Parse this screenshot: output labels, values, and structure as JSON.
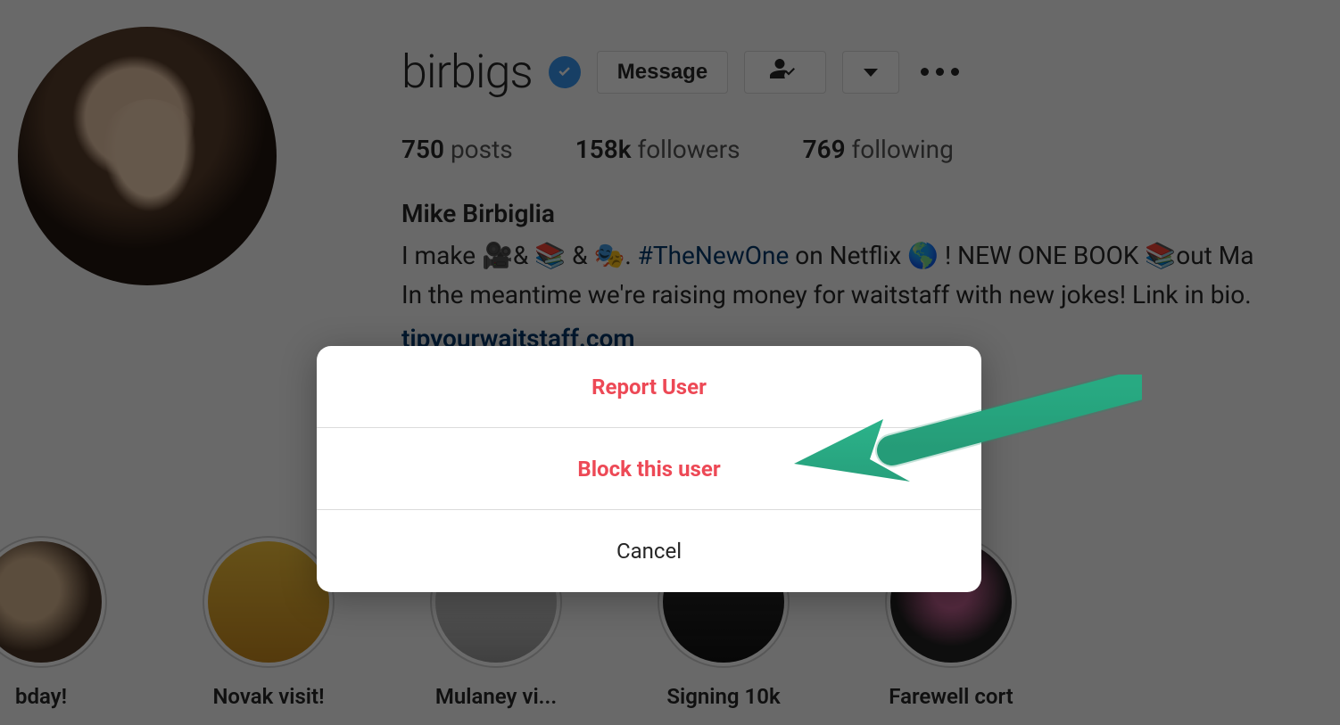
{
  "profile": {
    "username": "birbigs",
    "verified": true,
    "message_button_label": "Message",
    "stats": {
      "posts_count": "750",
      "posts_label": "posts",
      "followers_count": "158k",
      "followers_label": "followers",
      "following_count": "769",
      "following_label": "following"
    },
    "display_name": "Mike Birbiglia",
    "bio_line1_prefix": "I make 🎥& 📚 & 🎭. ",
    "bio_hashtag": "#TheNewOne",
    "bio_line1_suffix": " on Netflix 🌎 ! NEW ONE BOOK 📚out Ma",
    "bio_line2": "In the meantime we're raising money for waitstaff with new jokes! Link in bio.",
    "bio_link": "tipyourwaitstaff.com"
  },
  "highlights": [
    {
      "label": "bday!"
    },
    {
      "label": "Novak visit!"
    },
    {
      "label": "Mulaney vi..."
    },
    {
      "label": "Signing 10k"
    },
    {
      "label": "Farewell cort"
    }
  ],
  "modal": {
    "report_label": "Report User",
    "block_label": "Block this user",
    "cancel_label": "Cancel"
  },
  "annotation": {
    "arrow_color": "#2bb38a"
  }
}
